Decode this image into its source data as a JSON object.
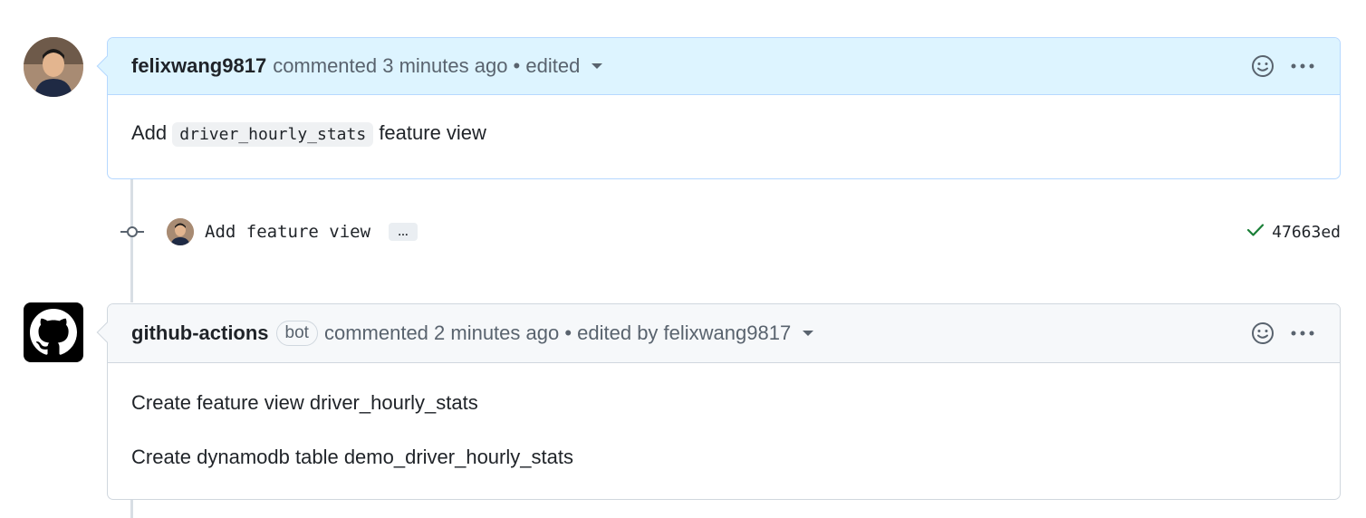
{
  "comment1": {
    "author": "felixwang9817",
    "meta": "commented 3 minutes ago • edited",
    "body_prefix": "Add",
    "body_code": "driver_hourly_stats",
    "body_suffix": "feature view"
  },
  "commit": {
    "message": "Add feature view",
    "ellipsis": "…",
    "sha": "47663ed",
    "status_color": "#1a7f37"
  },
  "comment2": {
    "author": "github-actions",
    "badge": "bot",
    "meta": "commented 2 minutes ago • edited by felixwang9817",
    "body_lines": [
      "Create feature view driver_hourly_stats",
      "Create dynamodb table demo_driver_hourly_stats"
    ]
  },
  "colors": {
    "accent_bg": "#ddf4ff",
    "accent_border": "#b6d8ff",
    "muted_text": "#59636e"
  }
}
